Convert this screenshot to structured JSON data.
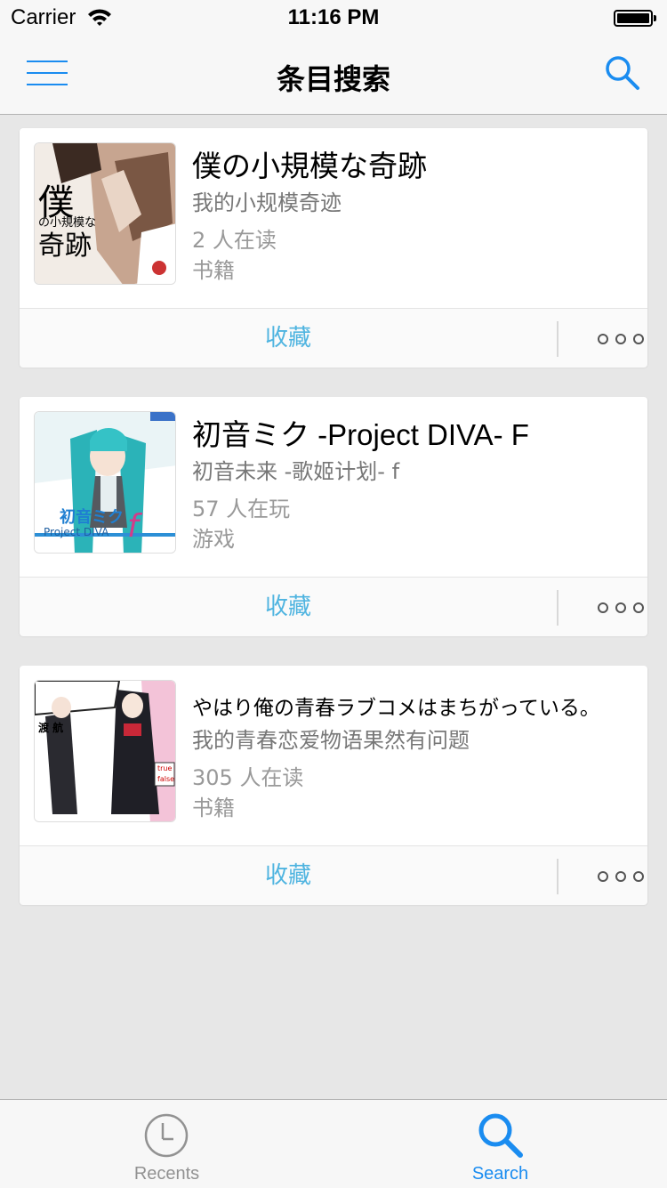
{
  "status_bar": {
    "carrier": "Carrier",
    "time": "11:16 PM"
  },
  "nav": {
    "title": "条目搜索"
  },
  "results": [
    {
      "title": "僕の小規模な奇跡",
      "subtitle": "我的小规模奇迹",
      "readers": "2 人在读",
      "category": "书籍",
      "favorite_label": "收藏",
      "cover_text": "僕",
      "cover_text2": "の小規模な",
      "cover_text3": "奇跡"
    },
    {
      "title": "初音ミク -Project DIVA- F",
      "subtitle": "初音未来 -歌姬计划- f",
      "readers": "57 人在玩",
      "category": "游戏",
      "favorite_label": "收藏",
      "cover_text": "初音ミク",
      "cover_text2": "Project DIVA",
      "cover_text3": "f"
    },
    {
      "title": "やはり俺の青春ラブコメはまちがっている。",
      "subtitle": "我的青春恋爱物语果然有问题",
      "readers": "305 人在读",
      "category": "书籍",
      "favorite_label": "收藏",
      "cover_text": "渡 航",
      "cover_text2": "true",
      "cover_text3": "false"
    }
  ],
  "tabs": [
    {
      "label": "Recents",
      "icon": "clock-icon",
      "active": false
    },
    {
      "label": "Search",
      "icon": "search-icon",
      "active": true
    }
  ],
  "colors": {
    "accent": "#1a8cf0",
    "favorite": "#4fb4e0",
    "inactive_tab": "#929292"
  }
}
